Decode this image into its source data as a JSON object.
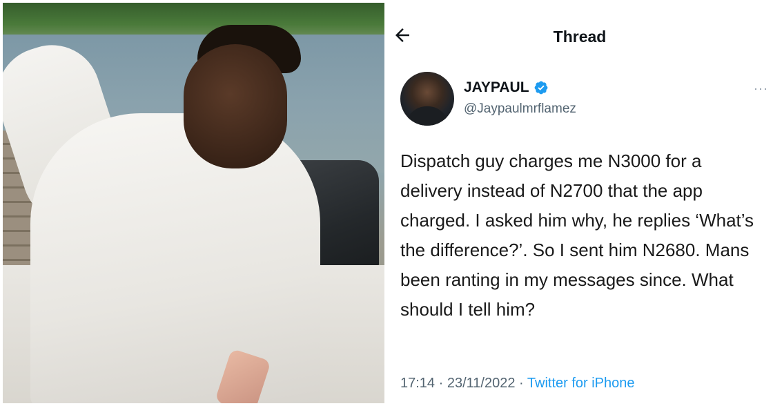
{
  "header": {
    "title": "Thread"
  },
  "author": {
    "display_name": "JAYPAUL",
    "handle": "@Jaypaulmrflamez",
    "verified": true
  },
  "tweet": {
    "text": "Dispatch guy charges me N3000 for a delivery instead of N2700 that the app charged. I asked him why, he replies ‘What’s the difference?’. So I sent him N2680. Mans been ranting in my messages since. What should I tell him?",
    "time": "17:14",
    "separator1": " · ",
    "date": "23/11/2022",
    "separator2": " · ",
    "source": "Twitter for iPhone"
  },
  "icons": {
    "back": "back-arrow-icon",
    "verified": "verified-badge-icon",
    "more": "more-icon"
  },
  "colors": {
    "accent": "#1d9bf0",
    "text": "#0f1419",
    "muted": "#536471"
  }
}
